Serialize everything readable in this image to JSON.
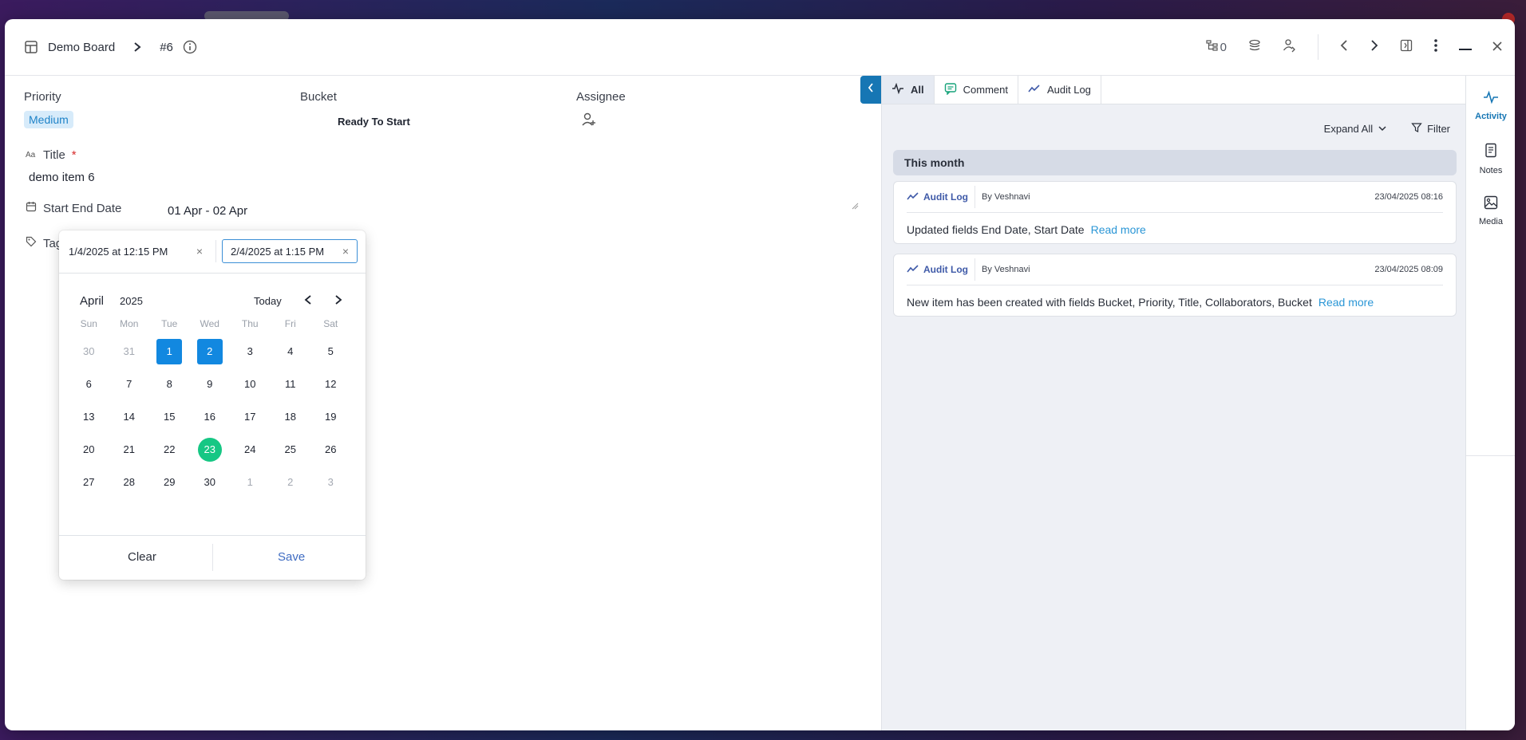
{
  "header": {
    "board_name": "Demo Board",
    "item_id": "#6",
    "link_count": "0"
  },
  "fields": {
    "priority_label": "Priority",
    "priority_value": "Medium",
    "bucket_label": "Bucket",
    "bucket_value": "Ready To Start",
    "assignee_label": "Assignee",
    "title_label": "Title",
    "title_required_mark": "*",
    "title_value": "demo item 6",
    "date_label": "Start End Date",
    "date_value": "01 Apr  -  02 Apr",
    "tags_label": "Tag"
  },
  "date_picker": {
    "start_value": "1/4/2025 at  12:15 PM",
    "end_value": "2/4/2025 at  1:15 PM",
    "clear_glyph": "×",
    "month": "April",
    "year": "2025",
    "today_label": "Today",
    "weekdays": [
      "Sun",
      "Mon",
      "Tue",
      "Wed",
      "Thu",
      "Fri",
      "Sat"
    ],
    "days": [
      {
        "d": "30",
        "s": "muted"
      },
      {
        "d": "31",
        "s": "muted"
      },
      {
        "d": "1",
        "s": "sel"
      },
      {
        "d": "2",
        "s": "sel"
      },
      {
        "d": "3",
        "s": ""
      },
      {
        "d": "4",
        "s": ""
      },
      {
        "d": "5",
        "s": ""
      },
      {
        "d": "6",
        "s": ""
      },
      {
        "d": "7",
        "s": ""
      },
      {
        "d": "8",
        "s": ""
      },
      {
        "d": "9",
        "s": ""
      },
      {
        "d": "10",
        "s": ""
      },
      {
        "d": "11",
        "s": ""
      },
      {
        "d": "12",
        "s": ""
      },
      {
        "d": "13",
        "s": ""
      },
      {
        "d": "14",
        "s": ""
      },
      {
        "d": "15",
        "s": ""
      },
      {
        "d": "16",
        "s": ""
      },
      {
        "d": "17",
        "s": ""
      },
      {
        "d": "18",
        "s": ""
      },
      {
        "d": "19",
        "s": ""
      },
      {
        "d": "20",
        "s": ""
      },
      {
        "d": "21",
        "s": ""
      },
      {
        "d": "22",
        "s": ""
      },
      {
        "d": "23",
        "s": "today"
      },
      {
        "d": "24",
        "s": ""
      },
      {
        "d": "25",
        "s": ""
      },
      {
        "d": "26",
        "s": ""
      },
      {
        "d": "27",
        "s": ""
      },
      {
        "d": "28",
        "s": ""
      },
      {
        "d": "29",
        "s": ""
      },
      {
        "d": "30",
        "s": ""
      },
      {
        "d": "1",
        "s": "muted"
      },
      {
        "d": "2",
        "s": "muted"
      },
      {
        "d": "3",
        "s": "muted"
      }
    ],
    "clear_label": "Clear",
    "save_label": "Save"
  },
  "activity": {
    "tabs": [
      {
        "label": "All",
        "icon": "activity-icon"
      },
      {
        "label": "Comment",
        "icon": "comment-icon"
      },
      {
        "label": "Audit Log",
        "icon": "trend-icon"
      }
    ],
    "expand_label": "Expand All",
    "filter_label": "Filter",
    "group_label": "This month",
    "entries": [
      {
        "kind": "Audit Log",
        "author": "By Veshnavi",
        "time": "23/04/2025 08:16",
        "message": "Updated fields End Date, Start Date",
        "more": "Read more"
      },
      {
        "kind": "Audit Log",
        "author": "By Veshnavi",
        "time": "23/04/2025 08:09",
        "message": "New item has been created with fields Bucket, Priority, Title, Collaborators, Bucket",
        "more": "Read more"
      }
    ]
  },
  "rail": {
    "items": [
      {
        "label": "Activity",
        "icon": "activity-icon"
      },
      {
        "label": "Notes",
        "icon": "notes-icon"
      },
      {
        "label": "Media",
        "icon": "image-icon"
      }
    ]
  },
  "colors": {
    "accent": "#1676b4",
    "selected_day": "#1288e0",
    "today_day": "#16c784",
    "priority_badge_bg": "#d7ebfa",
    "link": "#2a96d6"
  }
}
